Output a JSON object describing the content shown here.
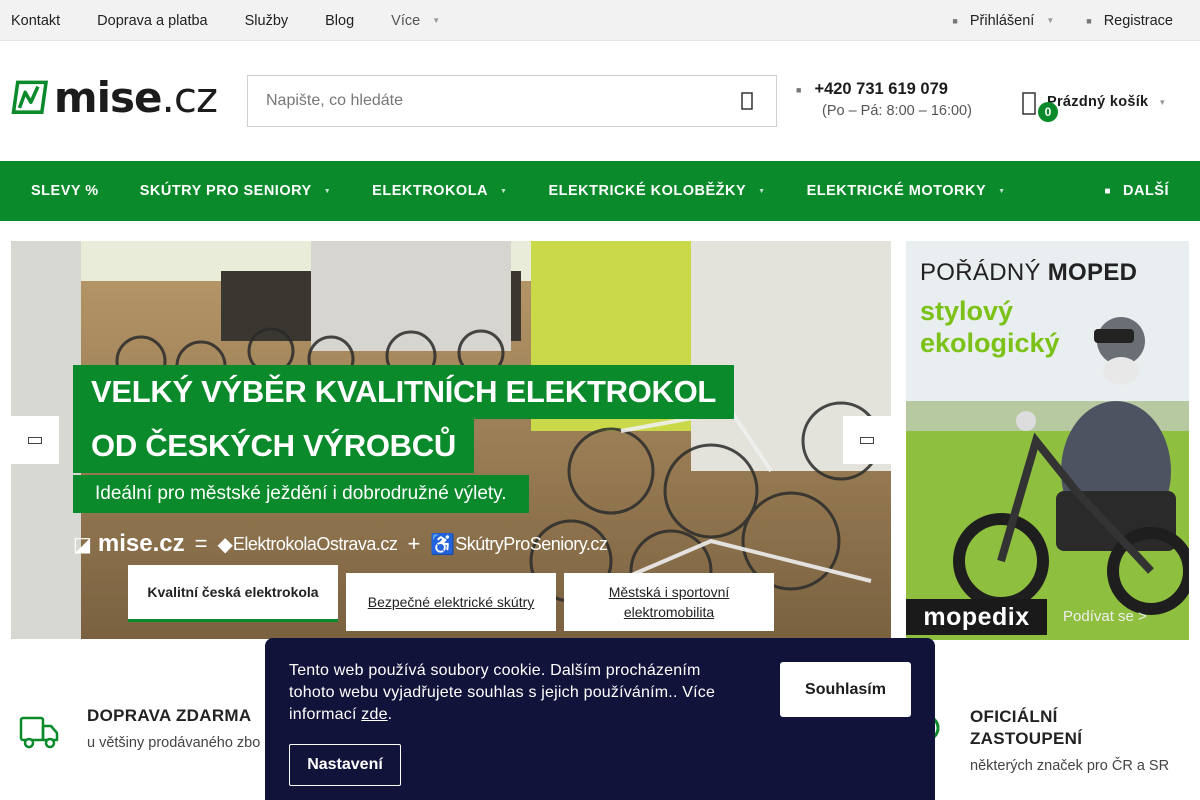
{
  "topbar": {
    "links": [
      "Kontakt",
      "Doprava a platba",
      "Služby",
      "Blog"
    ],
    "more_label": "Více",
    "login_label": "Přihlášení",
    "register_label": "Registrace"
  },
  "header": {
    "logo_text": "mise",
    "logo_tld": ".cz",
    "search_placeholder": "Napište, co hledáte",
    "phone": "+420 731 619 079",
    "hours": "(Po – Pá: 8:00 – 16:00)",
    "cart_count": "0",
    "cart_label": "Prázdný košík"
  },
  "nav": {
    "items": [
      "SLEVY %",
      "SKÚTRY PRO SENIORY",
      "ELEKTROKOLA",
      "ELEKTRICKÉ KOLOBĚŽKY",
      "ELEKTRICKÉ MOTORKY"
    ],
    "more_label": "DALŠÍ"
  },
  "hero": {
    "headline_1": "VELKÝ VÝBĚR KVALITNÍCH ELEKTROKOL",
    "headline_2": "OD ČESKÝCH VÝROBCŮ",
    "subline": "Ideální pro městské ježdění i dobrodružné výlety.",
    "brand_mise": "mise.cz",
    "brand_eq": "=",
    "brand_a": "ElektrokolaOstrava.cz",
    "brand_plus": "+",
    "brand_b": "SkútryProSeniory.cz",
    "tabs": [
      "Kvalitní česká elektrokola",
      "Bezpečné elektrické skútry",
      "Městská i sportovní elektromobilita"
    ]
  },
  "side_banner": {
    "line_1_normal": "POŘÁDNÝ",
    "line_1_bold": "MOPED",
    "line_2": "stylový",
    "line_3": "ekologický",
    "brand": "mopedix",
    "cta": "Podívat se >"
  },
  "benefits": [
    {
      "title": "DOPRAVA ZDARMA",
      "text": "u většiny prodávaného zbo"
    },
    {
      "title": "OFICIÁLNÍ ZASTOUPENÍ",
      "text": "některých značek pro ČR a SR"
    }
  ],
  "cookie": {
    "message": "Tento web používá soubory cookie. Dalším procházením tohoto webu vyjadřujete souhlas s jejich používáním.. Více informací",
    "link_label": "zde",
    "link_suffix": ".",
    "agree_label": "Souhlasím",
    "settings_label": "Nastavení"
  },
  "colors": {
    "brand_green": "#0a8a2a",
    "cookie_bg": "#12133a",
    "lime": "#7cc118"
  }
}
